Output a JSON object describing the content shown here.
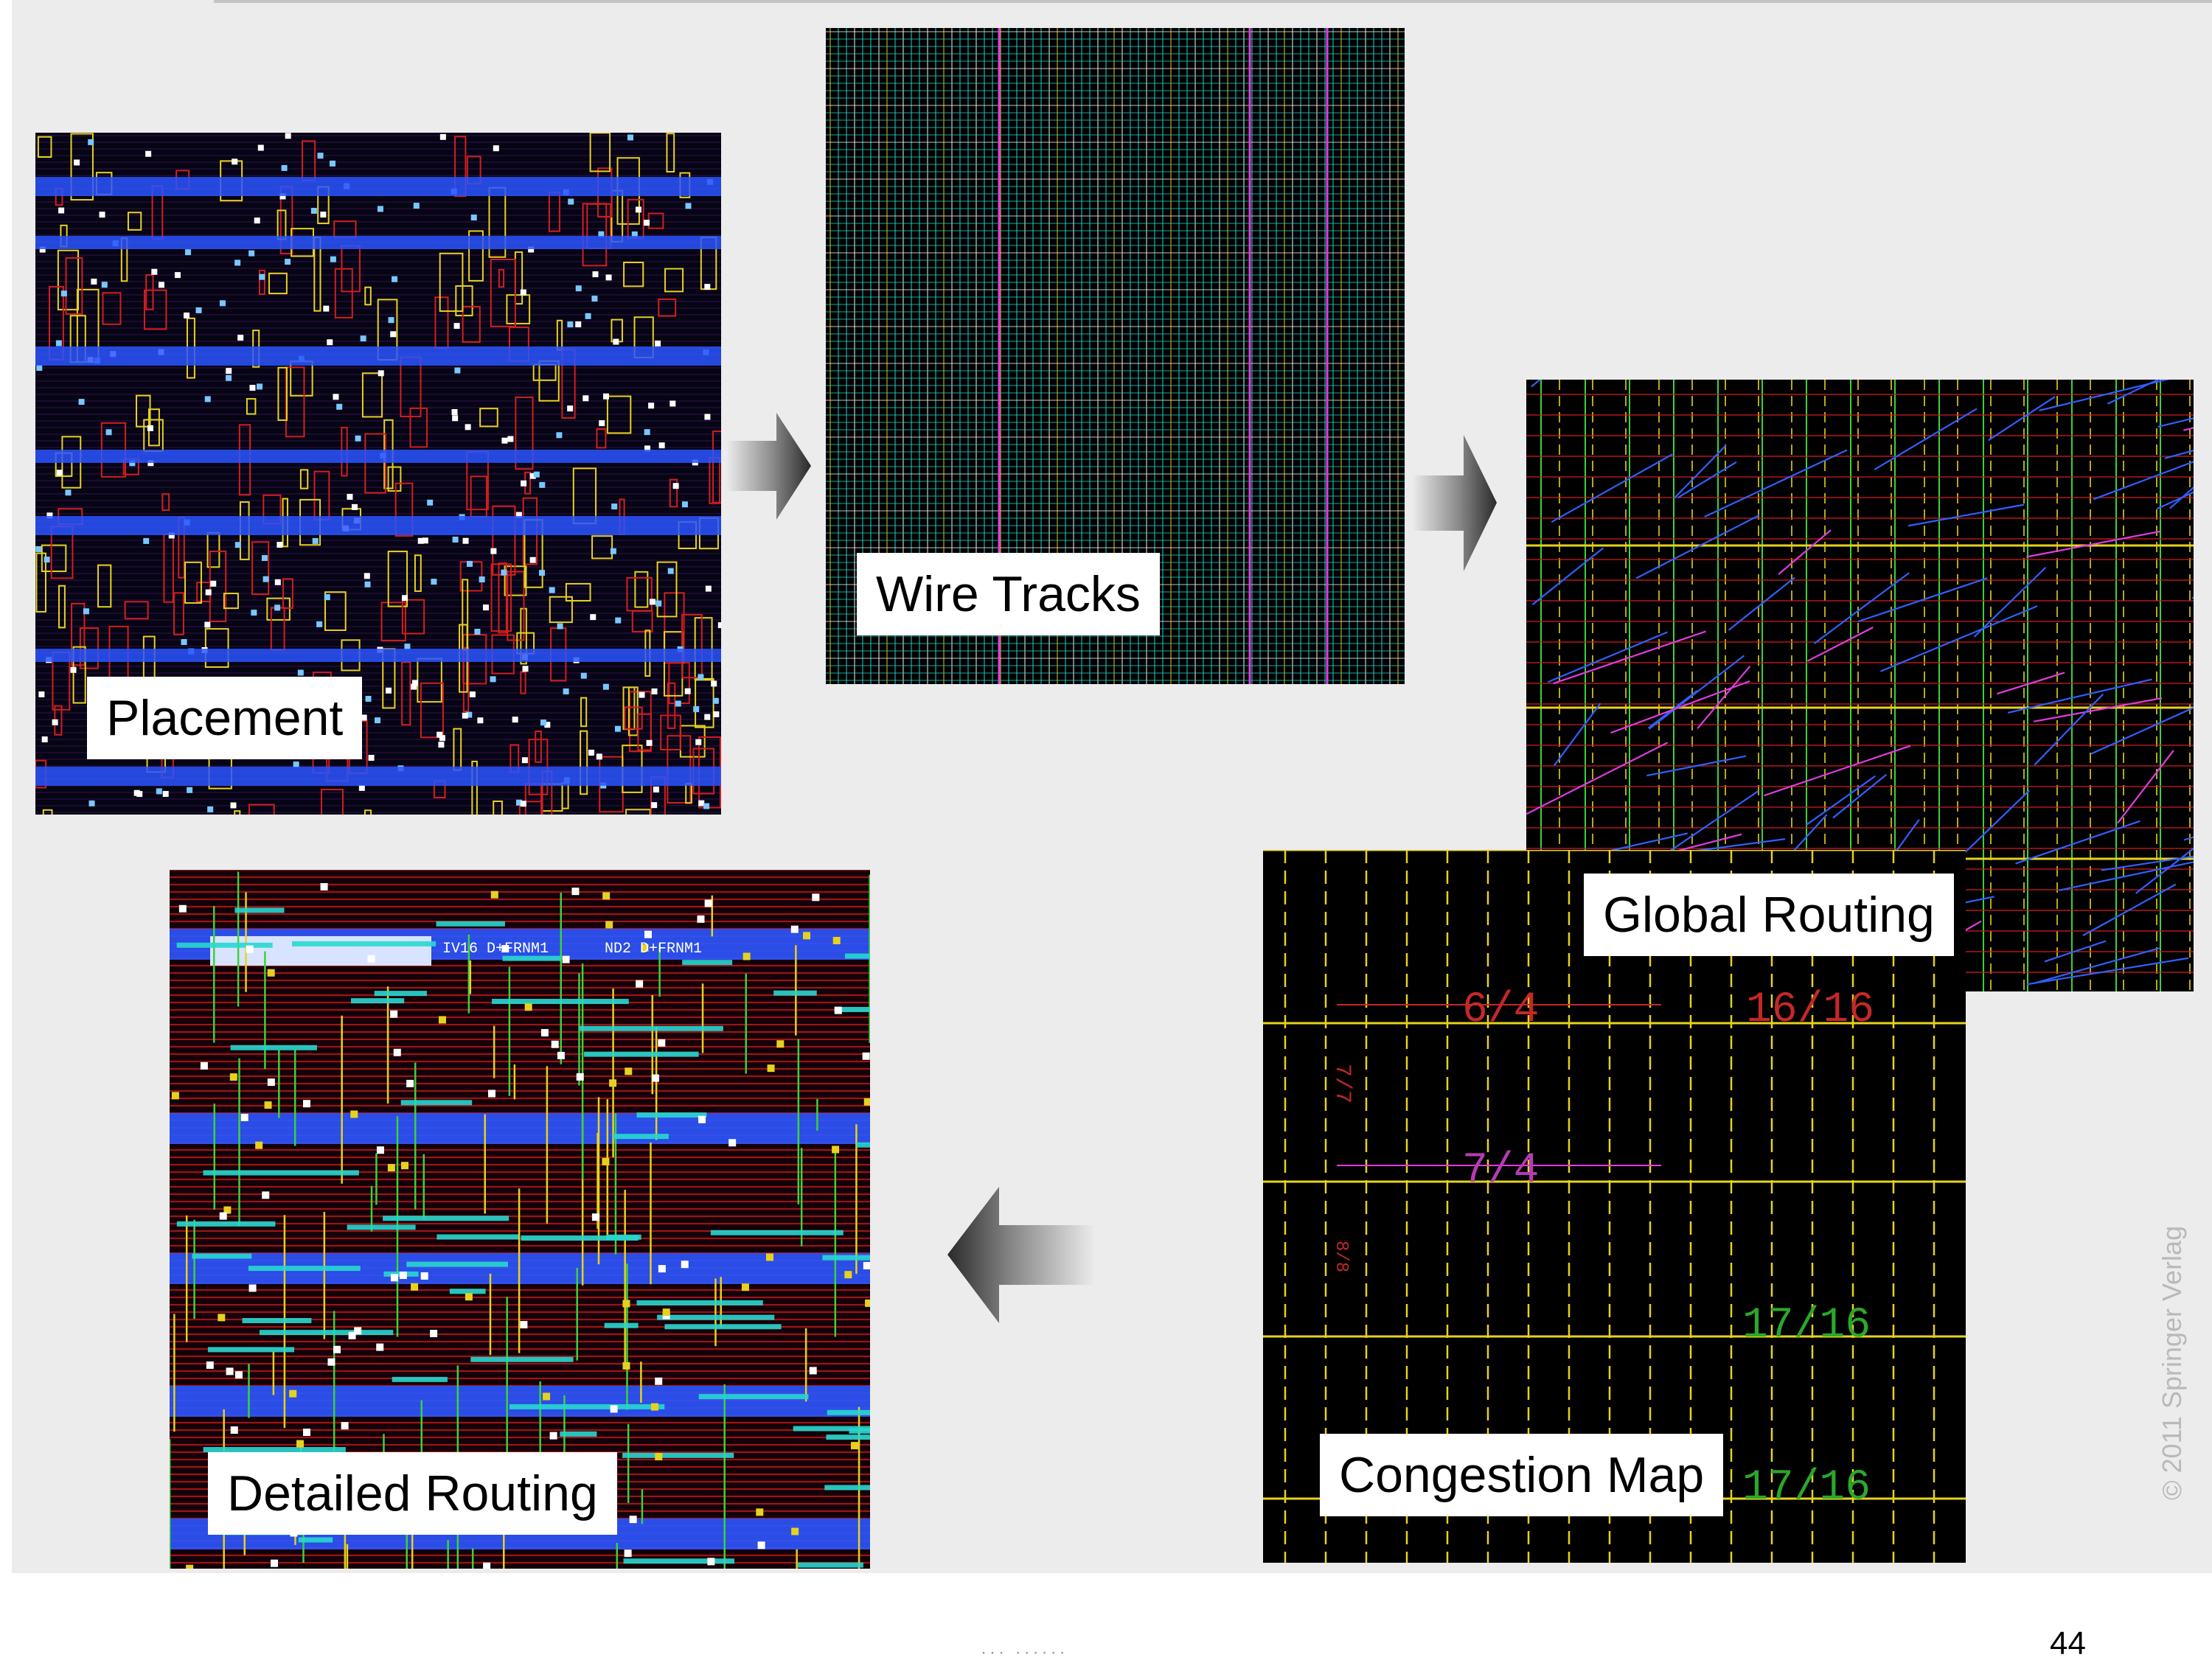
{
  "panels": {
    "placement": {
      "label": "Placement"
    },
    "wire_tracks": {
      "label": "Wire Tracks"
    },
    "global_routing": {
      "label": "Global Routing"
    },
    "congestion_map": {
      "label": "Congestion Map",
      "ratios": [
        "6/4",
        "16/16",
        "7/4",
        "17/16",
        "17/16"
      ],
      "vertical_ratios": [
        "7/7",
        "8/8"
      ]
    },
    "detailed_routing": {
      "label": "Detailed Routing",
      "cell_labels": [
        "IV16  D+FRNM1",
        "ND2  D+FRNM1"
      ]
    }
  },
  "copyright": "© 2011 Springer Verlag",
  "page_number": "44",
  "footer_text": "··· ······",
  "colors": {
    "background_panel": "#ececec",
    "layout_black": "#000000",
    "metal_blue": "#2b55ff",
    "metal_yellow": "#e6d21e",
    "metal_red": "#d21e1e",
    "metal_magenta": "#e03ce0",
    "metal_cyan": "#28d8d0",
    "metal_green": "#3cd23c"
  },
  "icons": {
    "flow_arrow": "arrow-icon"
  }
}
